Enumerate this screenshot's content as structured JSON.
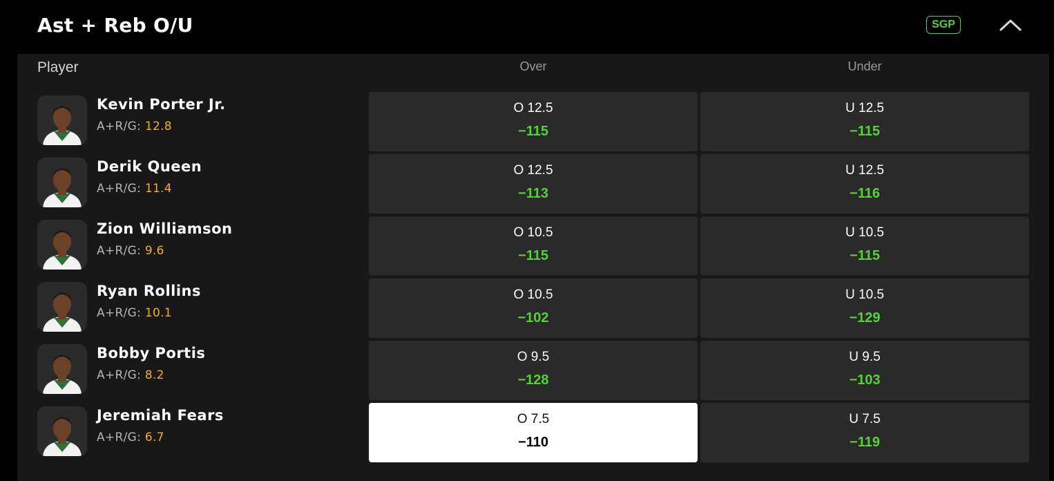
{
  "market": {
    "title": "Ast + Reb O/U",
    "badge": "SGP",
    "collapse_icon": "chevron-up-icon"
  },
  "columns": {
    "player": "Player",
    "over": "Over",
    "under": "Under"
  },
  "stat_label": "A+R/G:",
  "colors": {
    "odds": "#53d337",
    "stat_value": "#f0b21b",
    "selected_bg": "#ffffff"
  },
  "players": [
    {
      "name": "Kevin Porter Jr.",
      "stat": "12.8",
      "over_line": "O 12.5",
      "over_odds": "−115",
      "under_line": "U 12.5",
      "under_odds": "−115"
    },
    {
      "name": "Derik Queen",
      "stat": "11.4",
      "over_line": "O 12.5",
      "over_odds": "−113",
      "under_line": "U 12.5",
      "under_odds": "−116"
    },
    {
      "name": "Zion Williamson",
      "stat": "9.6",
      "over_line": "O 10.5",
      "over_odds": "−115",
      "under_line": "U 10.5",
      "under_odds": "−115"
    },
    {
      "name": "Ryan Rollins",
      "stat": "10.1",
      "over_line": "O 10.5",
      "over_odds": "−102",
      "under_line": "U 10.5",
      "under_odds": "−129"
    },
    {
      "name": "Bobby Portis",
      "stat": "8.2",
      "over_line": "O 9.5",
      "over_odds": "−128",
      "under_line": "U 9.5",
      "under_odds": "−103"
    },
    {
      "name": "Jeremiah Fears",
      "stat": "6.7",
      "over_line": "O 7.5",
      "over_odds": "−110",
      "under_line": "U 7.5",
      "under_odds": "−119",
      "selected": "over"
    }
  ]
}
